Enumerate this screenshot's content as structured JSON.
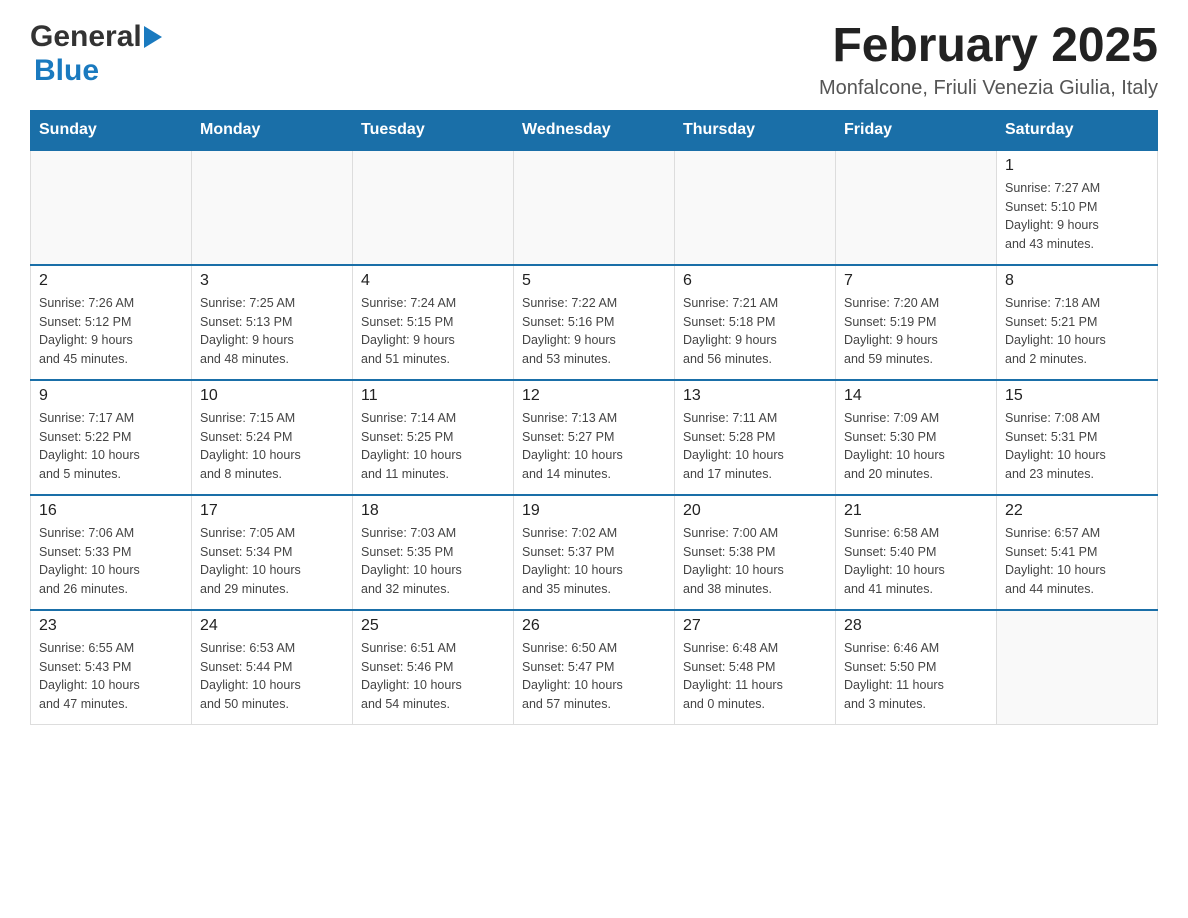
{
  "header": {
    "logo_general": "General",
    "logo_blue": "Blue",
    "month_title": "February 2025",
    "location": "Monfalcone, Friuli Venezia Giulia, Italy"
  },
  "weekdays": [
    "Sunday",
    "Monday",
    "Tuesday",
    "Wednesday",
    "Thursday",
    "Friday",
    "Saturday"
  ],
  "weeks": [
    [
      {
        "day": "",
        "info": ""
      },
      {
        "day": "",
        "info": ""
      },
      {
        "day": "",
        "info": ""
      },
      {
        "day": "",
        "info": ""
      },
      {
        "day": "",
        "info": ""
      },
      {
        "day": "",
        "info": ""
      },
      {
        "day": "1",
        "info": "Sunrise: 7:27 AM\nSunset: 5:10 PM\nDaylight: 9 hours\nand 43 minutes."
      }
    ],
    [
      {
        "day": "2",
        "info": "Sunrise: 7:26 AM\nSunset: 5:12 PM\nDaylight: 9 hours\nand 45 minutes."
      },
      {
        "day": "3",
        "info": "Sunrise: 7:25 AM\nSunset: 5:13 PM\nDaylight: 9 hours\nand 48 minutes."
      },
      {
        "day": "4",
        "info": "Sunrise: 7:24 AM\nSunset: 5:15 PM\nDaylight: 9 hours\nand 51 minutes."
      },
      {
        "day": "5",
        "info": "Sunrise: 7:22 AM\nSunset: 5:16 PM\nDaylight: 9 hours\nand 53 minutes."
      },
      {
        "day": "6",
        "info": "Sunrise: 7:21 AM\nSunset: 5:18 PM\nDaylight: 9 hours\nand 56 minutes."
      },
      {
        "day": "7",
        "info": "Sunrise: 7:20 AM\nSunset: 5:19 PM\nDaylight: 9 hours\nand 59 minutes."
      },
      {
        "day": "8",
        "info": "Sunrise: 7:18 AM\nSunset: 5:21 PM\nDaylight: 10 hours\nand 2 minutes."
      }
    ],
    [
      {
        "day": "9",
        "info": "Sunrise: 7:17 AM\nSunset: 5:22 PM\nDaylight: 10 hours\nand 5 minutes."
      },
      {
        "day": "10",
        "info": "Sunrise: 7:15 AM\nSunset: 5:24 PM\nDaylight: 10 hours\nand 8 minutes."
      },
      {
        "day": "11",
        "info": "Sunrise: 7:14 AM\nSunset: 5:25 PM\nDaylight: 10 hours\nand 11 minutes."
      },
      {
        "day": "12",
        "info": "Sunrise: 7:13 AM\nSunset: 5:27 PM\nDaylight: 10 hours\nand 14 minutes."
      },
      {
        "day": "13",
        "info": "Sunrise: 7:11 AM\nSunset: 5:28 PM\nDaylight: 10 hours\nand 17 minutes."
      },
      {
        "day": "14",
        "info": "Sunrise: 7:09 AM\nSunset: 5:30 PM\nDaylight: 10 hours\nand 20 minutes."
      },
      {
        "day": "15",
        "info": "Sunrise: 7:08 AM\nSunset: 5:31 PM\nDaylight: 10 hours\nand 23 minutes."
      }
    ],
    [
      {
        "day": "16",
        "info": "Sunrise: 7:06 AM\nSunset: 5:33 PM\nDaylight: 10 hours\nand 26 minutes."
      },
      {
        "day": "17",
        "info": "Sunrise: 7:05 AM\nSunset: 5:34 PM\nDaylight: 10 hours\nand 29 minutes."
      },
      {
        "day": "18",
        "info": "Sunrise: 7:03 AM\nSunset: 5:35 PM\nDaylight: 10 hours\nand 32 minutes."
      },
      {
        "day": "19",
        "info": "Sunrise: 7:02 AM\nSunset: 5:37 PM\nDaylight: 10 hours\nand 35 minutes."
      },
      {
        "day": "20",
        "info": "Sunrise: 7:00 AM\nSunset: 5:38 PM\nDaylight: 10 hours\nand 38 minutes."
      },
      {
        "day": "21",
        "info": "Sunrise: 6:58 AM\nSunset: 5:40 PM\nDaylight: 10 hours\nand 41 minutes."
      },
      {
        "day": "22",
        "info": "Sunrise: 6:57 AM\nSunset: 5:41 PM\nDaylight: 10 hours\nand 44 minutes."
      }
    ],
    [
      {
        "day": "23",
        "info": "Sunrise: 6:55 AM\nSunset: 5:43 PM\nDaylight: 10 hours\nand 47 minutes."
      },
      {
        "day": "24",
        "info": "Sunrise: 6:53 AM\nSunset: 5:44 PM\nDaylight: 10 hours\nand 50 minutes."
      },
      {
        "day": "25",
        "info": "Sunrise: 6:51 AM\nSunset: 5:46 PM\nDaylight: 10 hours\nand 54 minutes."
      },
      {
        "day": "26",
        "info": "Sunrise: 6:50 AM\nSunset: 5:47 PM\nDaylight: 10 hours\nand 57 minutes."
      },
      {
        "day": "27",
        "info": "Sunrise: 6:48 AM\nSunset: 5:48 PM\nDaylight: 11 hours\nand 0 minutes."
      },
      {
        "day": "28",
        "info": "Sunrise: 6:46 AM\nSunset: 5:50 PM\nDaylight: 11 hours\nand 3 minutes."
      },
      {
        "day": "",
        "info": ""
      }
    ]
  ]
}
